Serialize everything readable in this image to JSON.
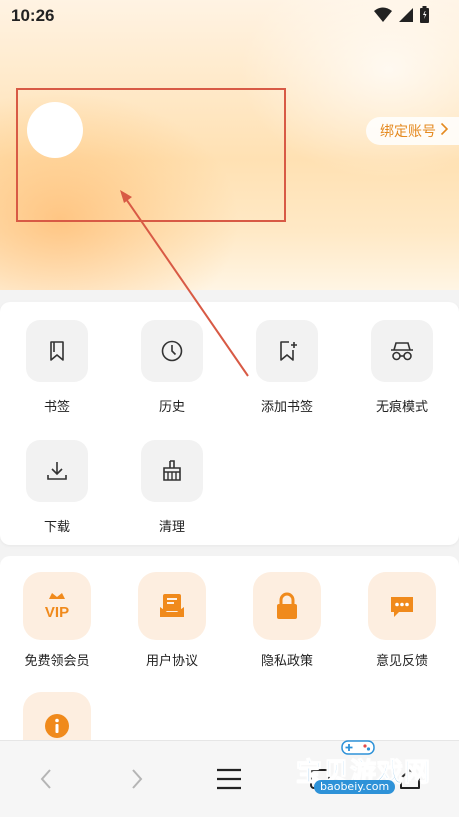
{
  "status": {
    "time": "10:26"
  },
  "header": {
    "bind_account_label": "绑定账号"
  },
  "tools": [
    {
      "label": "书签",
      "icon": "bookmark-icon"
    },
    {
      "label": "历史",
      "icon": "history-icon"
    },
    {
      "label": "添加书签",
      "icon": "add-bookmark-icon"
    },
    {
      "label": "无痕模式",
      "icon": "incognito-icon"
    },
    {
      "label": "下载",
      "icon": "download-icon"
    },
    {
      "label": "清理",
      "icon": "broom-icon"
    }
  ],
  "services": [
    {
      "label": "免费领会员",
      "icon": "vip-crown-icon",
      "badge": "VIP"
    },
    {
      "label": "用户协议",
      "icon": "agreement-icon"
    },
    {
      "label": "隐私政策",
      "icon": "lock-icon"
    },
    {
      "label": "意见反馈",
      "icon": "feedback-icon"
    },
    {
      "label": "",
      "icon": "info-icon"
    }
  ],
  "watermark": {
    "text": "宝贝游戏网",
    "url": "baobeiy.com"
  },
  "colors": {
    "accent": "#f08a1c",
    "annotation": "#d85a45",
    "tile": "#f2f2f2",
    "service_tile": "#fdeee0"
  }
}
